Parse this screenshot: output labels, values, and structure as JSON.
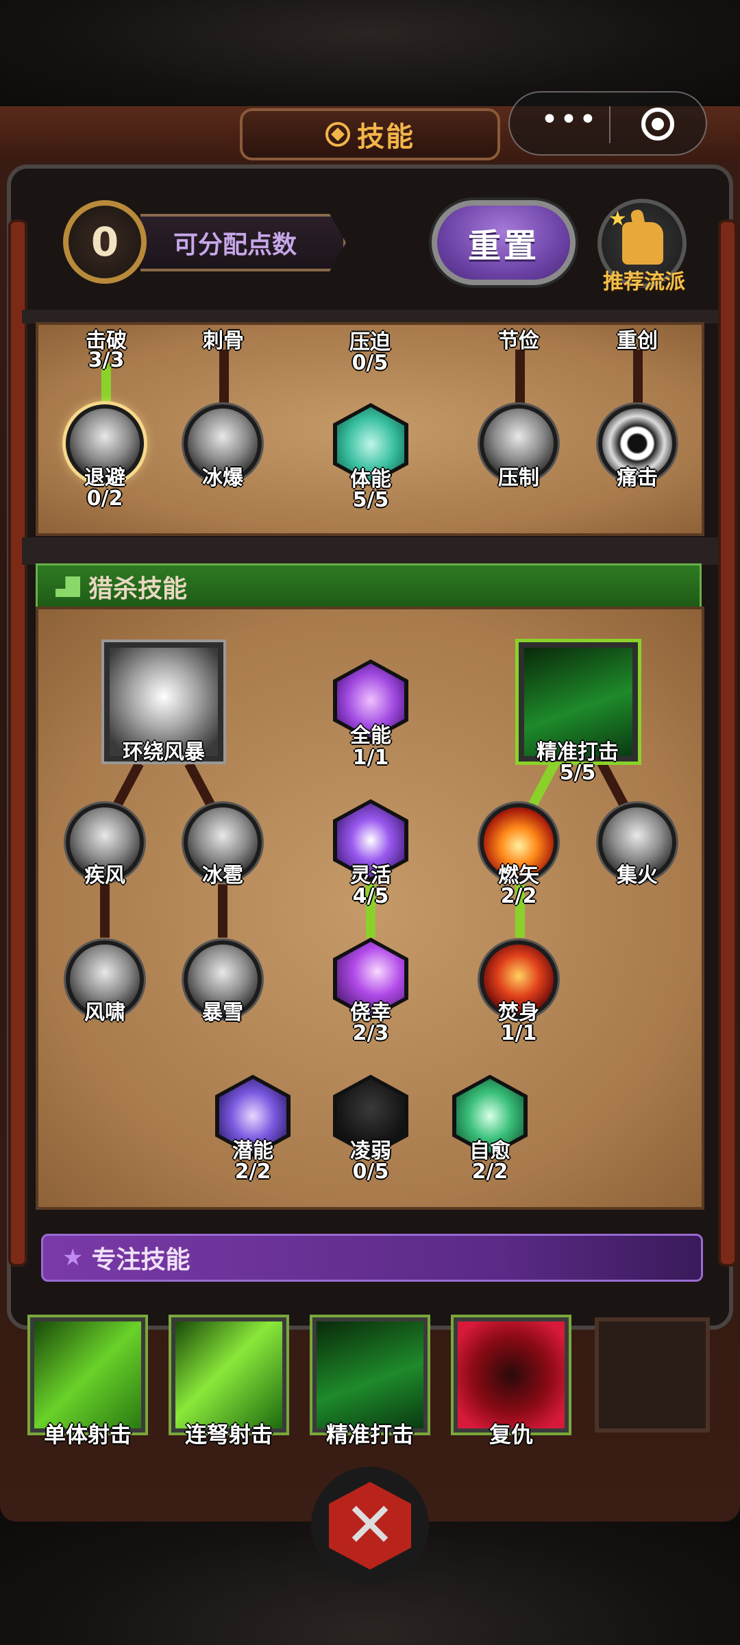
{
  "header": {
    "title": "技能"
  },
  "mini_program_capsule": {
    "more_label": "•••"
  },
  "points": {
    "value": "0",
    "label": "可分配点数"
  },
  "reset_button": {
    "label": "重置"
  },
  "recommend": {
    "label": "推荐流派"
  },
  "upper_panel": {
    "top_row": [
      {
        "name": "击破",
        "count": "3/3"
      },
      {
        "name": "刺骨",
        "count": ""
      },
      {
        "name": "压迫",
        "count": "0/5"
      },
      {
        "name": "节俭",
        "count": ""
      },
      {
        "name": "重创",
        "count": ""
      }
    ],
    "bottom_row": [
      {
        "name": "退避",
        "count": "0/2"
      },
      {
        "name": "冰爆",
        "count": ""
      },
      {
        "name": "体能",
        "count": "5/5"
      },
      {
        "name": "压制",
        "count": ""
      },
      {
        "name": "痛击",
        "count": ""
      }
    ]
  },
  "hunt_section": {
    "title": "猎杀技能",
    "skills": {
      "huanrao": {
        "name": "环绕风暴",
        "count": ""
      },
      "quanneng": {
        "name": "全能",
        "count": "1/1"
      },
      "jingzhun": {
        "name": "精准打击",
        "count": "5/5"
      },
      "jifeng": {
        "name": "疾风",
        "count": ""
      },
      "bingbao": {
        "name": "冰雹",
        "count": ""
      },
      "linghuo": {
        "name": "灵活",
        "count": "4/5"
      },
      "ranshi": {
        "name": "燃矢",
        "count": "2/2"
      },
      "jihuo": {
        "name": "集火",
        "count": ""
      },
      "fengxiao": {
        "name": "风啸",
        "count": ""
      },
      "baoxue": {
        "name": "暴雪",
        "count": ""
      },
      "raoxing": {
        "name": "侥幸",
        "count": "2/3"
      },
      "fenshen": {
        "name": "焚身",
        "count": "1/1"
      },
      "qianneng": {
        "name": "潜能",
        "count": "2/2"
      },
      "lingruo": {
        "name": "凌弱",
        "count": "0/5"
      },
      "ziyu": {
        "name": "自愈",
        "count": "2/2"
      }
    }
  },
  "focus_section": {
    "title": "专注技能",
    "slots": [
      {
        "name": "单体射击"
      },
      {
        "name": "连弩射击"
      },
      {
        "name": "精准打击"
      },
      {
        "name": "复仇"
      }
    ]
  },
  "colors": {
    "accent": "#f3b54a",
    "active_line": "#8ad22a",
    "hunt_green": "#2f7a22",
    "focus_purple": "#7a3aa8"
  }
}
